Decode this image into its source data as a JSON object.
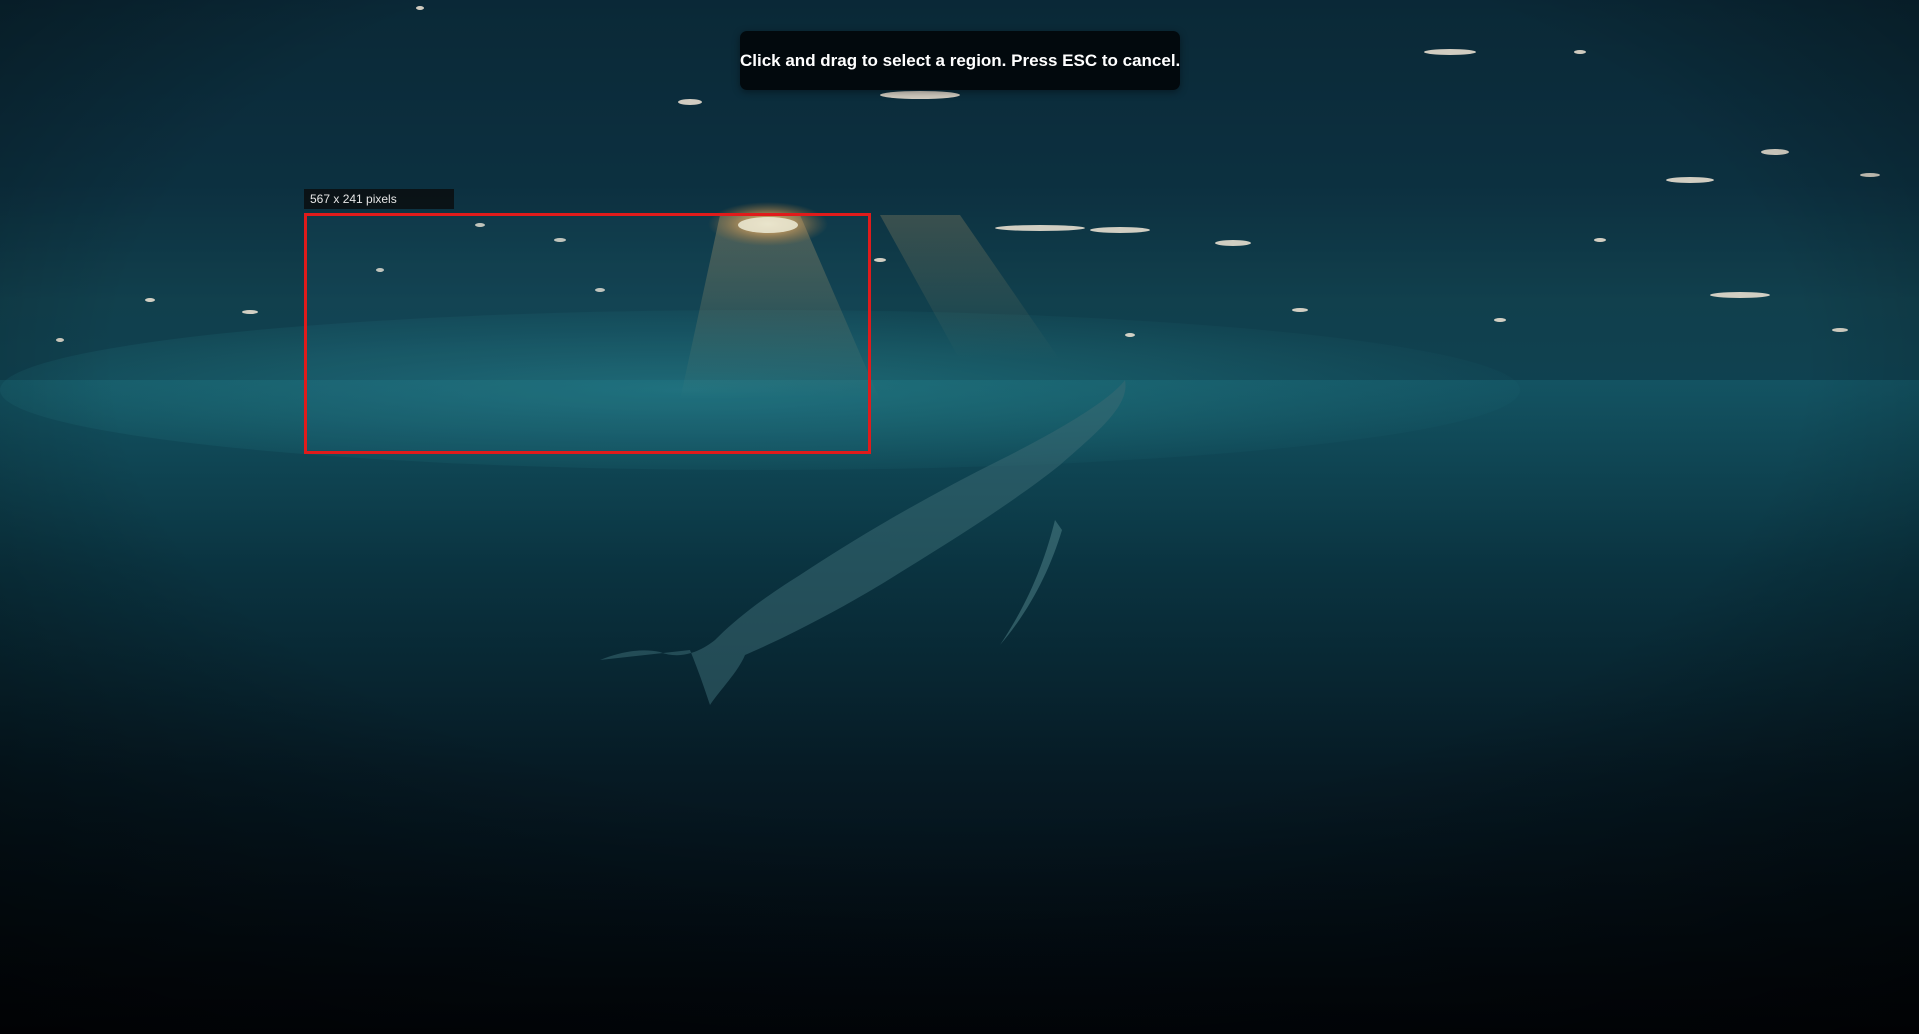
{
  "overlay": {
    "instruction": "Click and drag to select a region. Press ESC to cancel.",
    "selection_size_label": "567 x 241 pixels",
    "selection_border_color": "#e01b1b"
  },
  "background": {
    "description_icon": "underwater-whale-wallpaper"
  }
}
